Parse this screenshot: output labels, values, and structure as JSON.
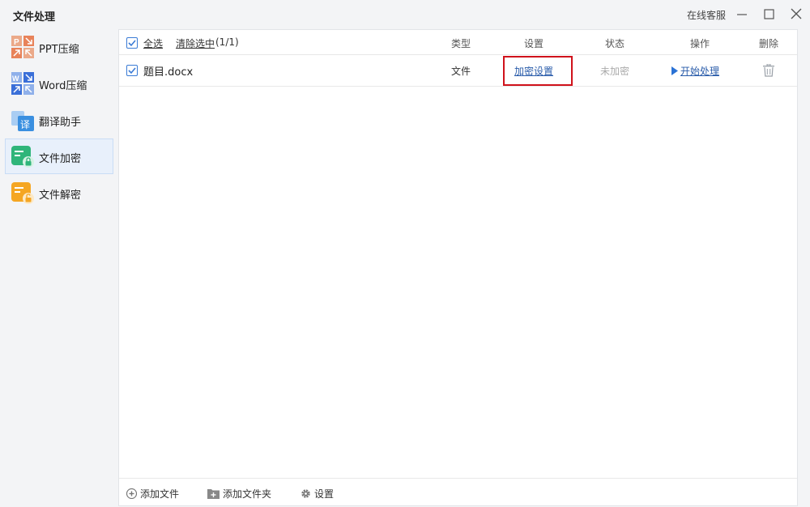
{
  "app": {
    "title": "文件处理",
    "support_link": "在线客服",
    "window_controls": [
      "minimize-icon",
      "maximize-icon",
      "close-icon"
    ]
  },
  "sidebar": {
    "items": [
      {
        "label": "PPT压缩",
        "icon": "ppt-compress-icon",
        "color": "#e8835a",
        "active": false
      },
      {
        "label": "Word压缩",
        "icon": "word-compress-icon",
        "color": "#3a6fd8",
        "active": false
      },
      {
        "label": "翻译助手",
        "icon": "translate-icon",
        "color": "#3a8fe0",
        "active": false
      },
      {
        "label": "文件加密",
        "icon": "file-encrypt-icon",
        "color": "#2fb57a",
        "active": true
      },
      {
        "label": "文件解密",
        "icon": "file-decrypt-icon",
        "color": "#f5a623",
        "active": false
      }
    ]
  },
  "table": {
    "select_all": "全选",
    "clear_selection": "清除选中",
    "selection_count": "(1/1)",
    "columns": {
      "type": "类型",
      "settings": "设置",
      "status": "状态",
      "action": "操作",
      "delete": "删除"
    },
    "rows": [
      {
        "checked": true,
        "filename": "题目.docx",
        "type": "文件",
        "settings": "加密设置",
        "status": "未加密",
        "action": "开始处理"
      }
    ]
  },
  "footer": {
    "add_file": "添加文件",
    "add_folder": "添加文件夹",
    "settings": "设置"
  },
  "colors": {
    "accent_link": "#2a5caa",
    "highlight_box": "#d0121b",
    "checkbox": "#3a7bd5"
  }
}
